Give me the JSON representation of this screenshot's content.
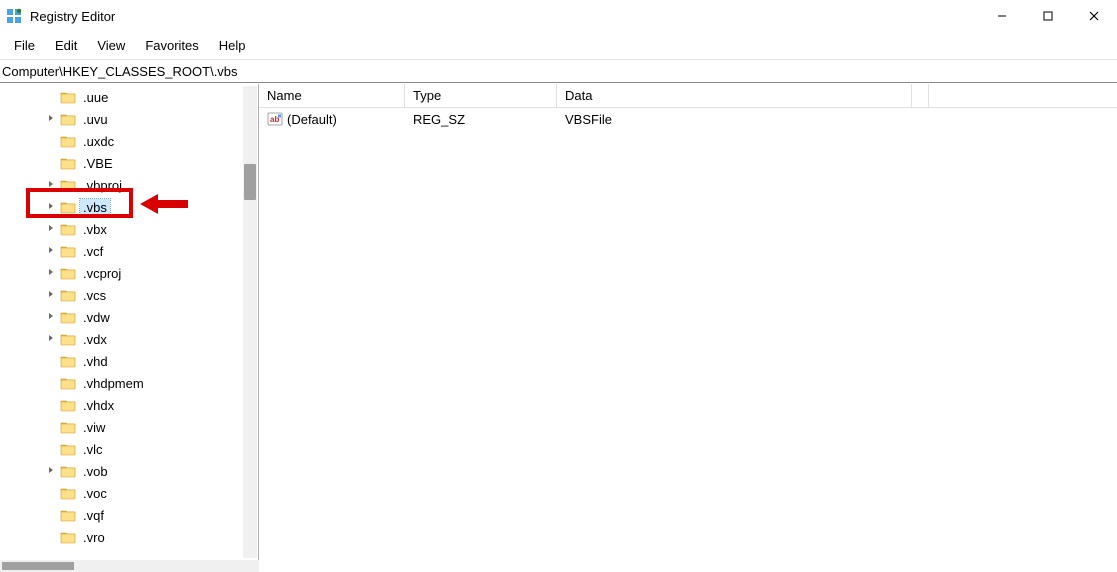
{
  "window": {
    "title": "Registry Editor"
  },
  "menu": {
    "file": "File",
    "edit": "Edit",
    "view": "View",
    "favorites": "Favorites",
    "help": "Help"
  },
  "address": "Computer\\HKEY_CLASSES_ROOT\\.vbs",
  "tree": {
    "items": [
      {
        "label": ".uue",
        "expandable": false,
        "selected": false
      },
      {
        "label": ".uvu",
        "expandable": true,
        "selected": false
      },
      {
        "label": ".uxdc",
        "expandable": false,
        "selected": false
      },
      {
        "label": ".VBE",
        "expandable": false,
        "selected": false
      },
      {
        "label": ".vbproj",
        "expandable": true,
        "selected": false
      },
      {
        "label": ".vbs",
        "expandable": true,
        "selected": true
      },
      {
        "label": ".vbx",
        "expandable": true,
        "selected": false
      },
      {
        "label": ".vcf",
        "expandable": true,
        "selected": false
      },
      {
        "label": ".vcproj",
        "expandable": true,
        "selected": false
      },
      {
        "label": ".vcs",
        "expandable": true,
        "selected": false
      },
      {
        "label": ".vdw",
        "expandable": true,
        "selected": false
      },
      {
        "label": ".vdx",
        "expandable": true,
        "selected": false
      },
      {
        "label": ".vhd",
        "expandable": false,
        "selected": false
      },
      {
        "label": ".vhdpmem",
        "expandable": false,
        "selected": false
      },
      {
        "label": ".vhdx",
        "expandable": false,
        "selected": false
      },
      {
        "label": ".viw",
        "expandable": false,
        "selected": false
      },
      {
        "label": ".vlc",
        "expandable": false,
        "selected": false
      },
      {
        "label": ".vob",
        "expandable": true,
        "selected": false
      },
      {
        "label": ".voc",
        "expandable": false,
        "selected": false
      },
      {
        "label": ".vqf",
        "expandable": false,
        "selected": false
      },
      {
        "label": ".vro",
        "expandable": false,
        "selected": false
      }
    ]
  },
  "columns": {
    "name": "Name",
    "type": "Type",
    "data": "Data"
  },
  "values": [
    {
      "name": "(Default)",
      "type": "REG_SZ",
      "data": "VBSFile"
    }
  ],
  "annotation": {
    "highlight_target": ".vbs"
  }
}
